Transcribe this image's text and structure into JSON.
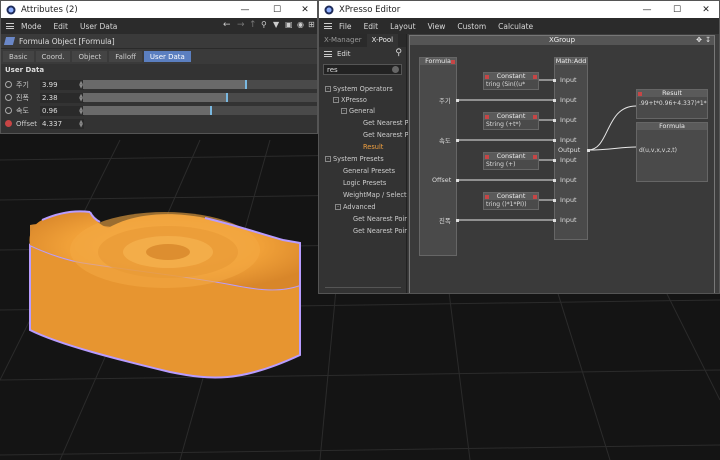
{
  "attributes": {
    "title": "Attributes (2)",
    "menu": [
      "Mode",
      "Edit",
      "User Data"
    ],
    "breadcrumb": "Formula Object [Formula]",
    "tabs": [
      "Basic",
      "Coord.",
      "Object",
      "Falloff",
      "User Data"
    ],
    "active_tab": "User Data",
    "section": "User Data",
    "params": [
      {
        "label": "주기",
        "value": "3.99",
        "fill": 0.7
      },
      {
        "label": "진폭",
        "value": "2.38",
        "fill": 0.62
      },
      {
        "label": "속도",
        "value": "0.96",
        "fill": 0.55
      },
      {
        "label": "Offset",
        "value": "4.337"
      }
    ]
  },
  "xpresso": {
    "title": "XPresso Editor",
    "menu": [
      "File",
      "Edit",
      "Layout",
      "View",
      "Custom",
      "Calculate"
    ],
    "left_tabs": [
      "X-Manager",
      "X-Pool"
    ],
    "active_left_tab": "X-Pool",
    "edit_label": "Edit",
    "search_value": "res",
    "tree": [
      {
        "label": "System Operators",
        "level": 0,
        "box": "-"
      },
      {
        "label": "XPresso",
        "level": 1,
        "box": "-"
      },
      {
        "label": "General",
        "level": 2,
        "box": "-"
      },
      {
        "label": "Get Nearest Poi",
        "level": 3
      },
      {
        "label": "Get Nearest Poi",
        "level": 3
      },
      {
        "label": "Result",
        "level": 3,
        "highlight": true
      },
      {
        "label": "System Presets",
        "level": 0,
        "box": "-"
      },
      {
        "label": "General Presets",
        "level": 1
      },
      {
        "label": "Logic Presets",
        "level": 1
      },
      {
        "label": "WeightMap / Select",
        "level": 1
      },
      {
        "label": "Advanced",
        "level": 1,
        "box": "-"
      },
      {
        "label": "Get Nearest Poir",
        "level": 2
      },
      {
        "label": "Get Nearest Poir",
        "level": 2
      }
    ],
    "group_title": "XGroup",
    "formula_node": {
      "title": "Formula",
      "ports": [
        "주기",
        "속도",
        "Offset",
        "진폭"
      ]
    },
    "constants": [
      {
        "title": "Constant",
        "body": "tring (Sin((u*"
      },
      {
        "title": "Constant",
        "body": "String (+t*)"
      },
      {
        "title": "Constant",
        "body": "String (+)"
      },
      {
        "title": "Constant",
        "body": "tring ()*1*PI))"
      }
    ],
    "math_node": {
      "title": "Math:Add",
      "inputs": [
        "Input",
        "Input",
        "Input",
        "Input",
        "Input",
        "Input",
        "Input",
        "Input"
      ],
      "output": "Output"
    },
    "result_node": {
      "title": "Result",
      "body": ".99+t*0.96+4.337)*1*PI))"
    },
    "formula_out_node": {
      "title": "Formula",
      "body": "d(u,v,x,v,z,t)"
    }
  },
  "colors": {
    "accent_tab": "#5b7fc0",
    "object_orange": "#f4a23a",
    "selection_outline": "#b89cff",
    "highlight_tree": "#f0a040"
  }
}
